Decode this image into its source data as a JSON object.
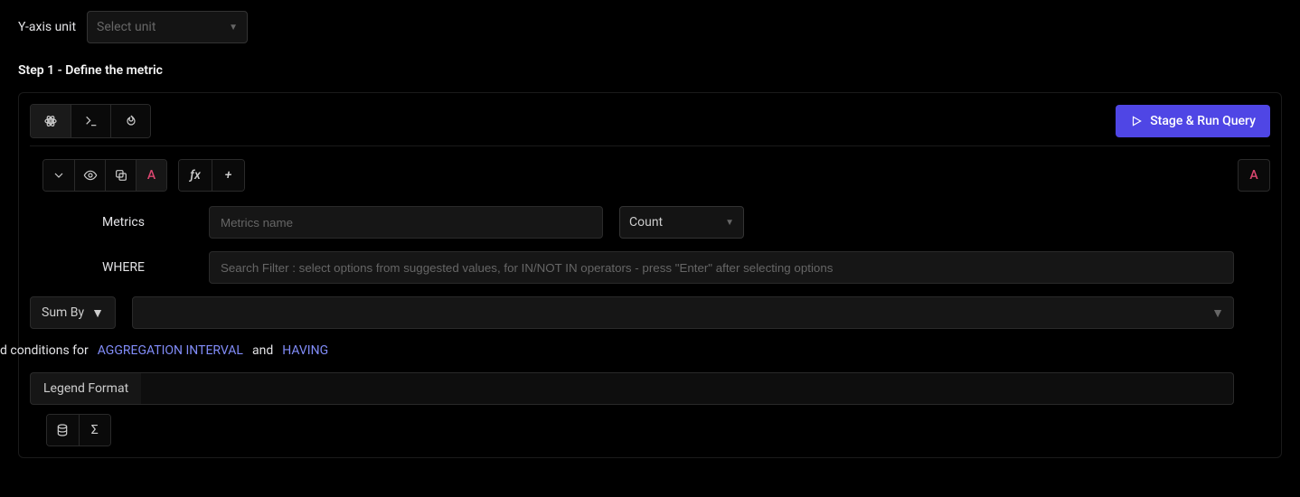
{
  "yaxis": {
    "label": "Y-axis unit",
    "placeholder": "Select unit"
  },
  "step_title": "Step 1 - Define the metric",
  "run_button": "Stage & Run Query",
  "query": {
    "letter": "A",
    "fx_label": "ƒx",
    "plus": "+",
    "metrics_label": "Metrics",
    "metrics_placeholder": "Metrics name",
    "agg_selected": "Count",
    "where_label": "WHERE",
    "where_placeholder": "Search Filter : select options from suggested values, for IN/NOT IN operators - press \"Enter\" after selecting options",
    "groupby_label": "Sum By",
    "conditions": {
      "prefix": "Add conditions for ",
      "agg_link": "AGGREGATION INTERVAL",
      "and": " and ",
      "having_link": "HAVING"
    },
    "legend_label": "Legend Format"
  },
  "footer_tools": {
    "sigma": "Σ"
  }
}
